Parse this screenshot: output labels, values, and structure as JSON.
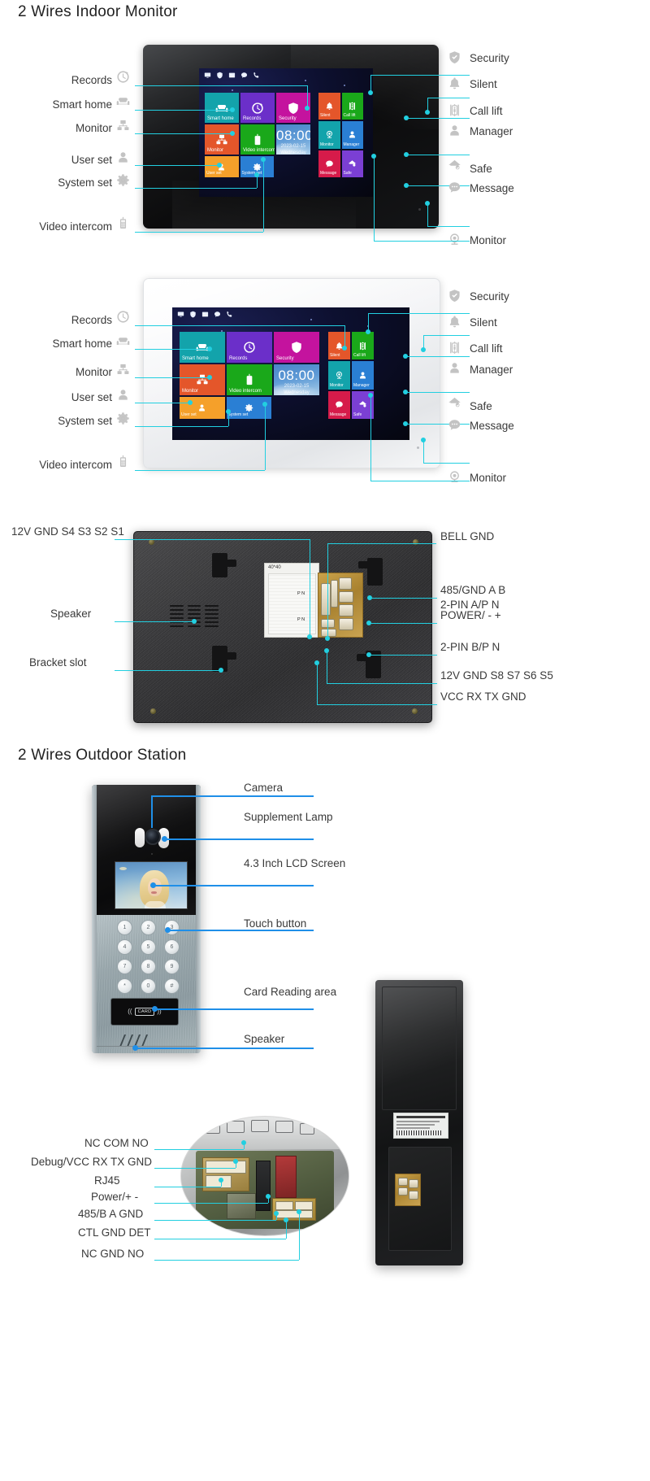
{
  "sections": {
    "indoor_title": "2 Wires Indoor Monitor",
    "outdoor_title": "2 Wires Outdoor Station"
  },
  "screen_ui": {
    "statusbar_icons": [
      "monitor-icon",
      "shield-check-icon",
      "picture-icon",
      "message-icon",
      "phone-icon"
    ],
    "clock": {
      "time": "08:00",
      "date": "2023-02-15",
      "weekday": "Wednesday"
    },
    "tiles_main": [
      {
        "label": "Smart home",
        "icon": "sofa-icon",
        "color": "#13a3ab"
      },
      {
        "label": "Records",
        "icon": "clock-icon",
        "color": "#6b2fc9"
      },
      {
        "label": "Security",
        "icon": "shield-check-icon",
        "color": "#c4139e"
      },
      {
        "label": "Monitor",
        "icon": "network-icon",
        "color": "#e4562a"
      },
      {
        "label": "Video intercom",
        "icon": "handset-icon",
        "color": "#1aa81a"
      },
      {
        "label": "User set",
        "icon": "person-icon",
        "color": "#f5a02a"
      },
      {
        "label": "System set",
        "icon": "gear-icon",
        "color": "#2a7fd4"
      }
    ],
    "tiles_side": [
      {
        "label": "Silent",
        "icon": "bell-icon",
        "color": "#e4562a"
      },
      {
        "label": "Call lift",
        "icon": "lift-icon",
        "color": "#1aa81a"
      },
      {
        "label": "Monitor",
        "icon": "webcam-icon",
        "color": "#13a3ab"
      },
      {
        "label": "Manager",
        "icon": "person-icon",
        "color": "#2a7fd4"
      },
      {
        "label": "Message",
        "icon": "message-icon",
        "color": "#d61b4a"
      },
      {
        "label": "Safe",
        "icon": "house-icon",
        "color": "#7b3fd4"
      }
    ]
  },
  "callouts_black_left": [
    {
      "label": "Records",
      "icon": "clock-icon"
    },
    {
      "label": "Smart home",
      "icon": "sofa-icon"
    },
    {
      "label": "Monitor",
      "icon": "network-icon"
    },
    {
      "label": "User set",
      "icon": "person-icon"
    },
    {
      "label": "System set",
      "icon": "gear-icon"
    },
    {
      "label": "Video intercom",
      "icon": "handset-icon"
    }
  ],
  "callouts_black_right": [
    {
      "label": "Security",
      "icon": "shield-check-icon"
    },
    {
      "label": "Silent",
      "icon": "bell-icon"
    },
    {
      "label": "Call lift",
      "icon": "lift-icon"
    },
    {
      "label": "Manager",
      "icon": "person-icon"
    },
    {
      "label": "Safe",
      "icon": "house-icon"
    },
    {
      "label": "Message",
      "icon": "message-icon"
    },
    {
      "label": "Monitor",
      "icon": "webcam-icon"
    }
  ],
  "callouts_white_left": [
    {
      "label": "Records",
      "icon": "clock-icon"
    },
    {
      "label": "Smart home",
      "icon": "sofa-icon"
    },
    {
      "label": "Monitor",
      "icon": "network-icon"
    },
    {
      "label": "User set",
      "icon": "person-icon"
    },
    {
      "label": "System set",
      "icon": "gear-icon"
    },
    {
      "label": "Video intercom",
      "icon": "handset-icon"
    }
  ],
  "callouts_white_right": [
    {
      "label": "Security",
      "icon": "shield-check-icon"
    },
    {
      "label": "Silent",
      "icon": "bell-icon"
    },
    {
      "label": "Call lift",
      "icon": "lift-icon"
    },
    {
      "label": "Manager",
      "icon": "person-icon"
    },
    {
      "label": "Safe",
      "icon": "house-icon"
    },
    {
      "label": "Message",
      "icon": "message-icon"
    },
    {
      "label": "Monitor",
      "icon": "webcam-icon"
    }
  ],
  "back_panel": {
    "left_labels": [
      "12V GND S4 S3 S2 S1",
      "Speaker",
      "Bracket slot"
    ],
    "right_labels": [
      "BELL GND",
      "485/GND A B",
      "2-PIN A/P N",
      "POWER/ - +",
      "2-PIN B/P N",
      "12V GND S8 S7 S6 S5",
      "VCC  RX TX GND"
    ],
    "sticker_title": "40*40",
    "sticker_marks": [
      "P N",
      "P N"
    ]
  },
  "outdoor_station": {
    "right_labels": [
      "Camera",
      "Supplement Lamp",
      "4.3 Inch LCD Screen",
      "Touch button",
      "Card Reading area",
      "Speaker"
    ],
    "keypad": [
      "1",
      "2",
      "3",
      "4",
      "5",
      "6",
      "7",
      "8",
      "9",
      "*",
      "0",
      "#"
    ],
    "card_label": "CARD"
  },
  "pcb_detail": {
    "left_labels": [
      "NC COM NO",
      "Debug/VCC RX TX GND",
      "RJ45",
      "Power/+ -",
      "485/B A GND",
      "CTL GND DET",
      "NC GND NO"
    ]
  },
  "colors": {
    "callout_line": "#22cfe0",
    "callout_line_blue": "#1f8fe8",
    "icon_grey": "#c3c3c3"
  }
}
